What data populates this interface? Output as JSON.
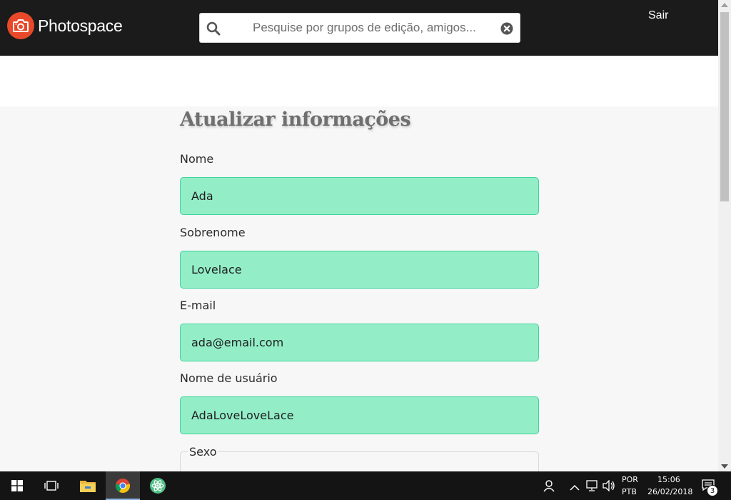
{
  "header": {
    "brand": "Photospace",
    "search_placeholder": "Pesquise por grupos de edição, amigos...",
    "logout_label": "Sair"
  },
  "form": {
    "title": "Atualizar informações",
    "fields": [
      {
        "label": "Nome",
        "value": "Ada"
      },
      {
        "label": "Sobrenome",
        "value": "Lovelace"
      },
      {
        "label": "E-mail",
        "value": "ada@email.com"
      },
      {
        "label": "Nome de usuário",
        "value": "AdaLoveLoveLace"
      }
    ],
    "gender_legend": "Sexo"
  },
  "taskbar": {
    "language_line1": "POR",
    "language_line2": "PTB",
    "time": "15:06",
    "date": "26/02/2018",
    "notification_count": "3",
    "apps": [
      "windows-start-icon",
      "task-view-icon",
      "file-explorer-icon",
      "chrome-icon",
      "atom-icon"
    ]
  },
  "colors": {
    "header_bg": "#1b1b1b",
    "brand_accent": "#e8492a",
    "input_fill": "#93eec8",
    "input_border": "#3ed59b",
    "content_bg": "#f7f7f7",
    "taskbar_bg": "#141414"
  }
}
